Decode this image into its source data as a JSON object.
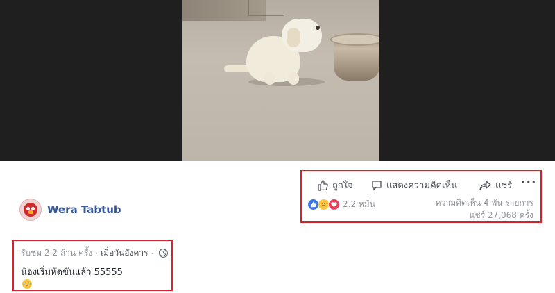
{
  "actions": {
    "like_label": "ถูกใจ",
    "comment_label": "แสดงความคิดเห็น",
    "share_label": "แชร์",
    "more_label": "•••"
  },
  "reactions": {
    "count": "2.2 หมื่น"
  },
  "stats": {
    "comments": "ความคิดเห็น 4 พัน รายการ",
    "shares": "แชร์ 27,068 ครั้ง"
  },
  "author": {
    "name": "Wera Tabtub"
  },
  "post": {
    "views": "รับชม 2.2 ล้าน ครั้ง",
    "separator": "·",
    "time": "เมื่อวันอังคาร",
    "caption": "น้องเริ่มหัดขันแล้ว 55555"
  },
  "colors": {
    "highlight_box": "#d9212b",
    "author_link": "#365899",
    "muted_text": "#90949c",
    "like_blue": "#3b78e7"
  }
}
